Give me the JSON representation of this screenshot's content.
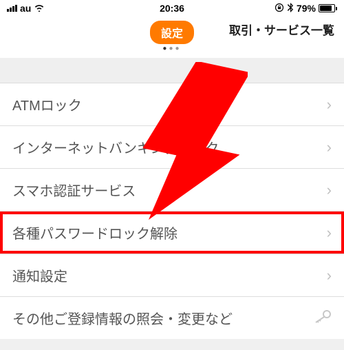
{
  "status_bar": {
    "carrier": "au",
    "time": "20:36",
    "battery_pct": "79%"
  },
  "header": {
    "settings_label": "設定",
    "right_link": "取引・サービス一覧"
  },
  "list": {
    "items": [
      {
        "label": "ATMロック"
      },
      {
        "label": "インターネットバンキングロック"
      },
      {
        "label": "スマホ認証サービス"
      },
      {
        "label": "各種パスワードロック解除"
      },
      {
        "label": "通知設定"
      },
      {
        "label": "その他ご登録情報の照会・変更など"
      }
    ]
  }
}
